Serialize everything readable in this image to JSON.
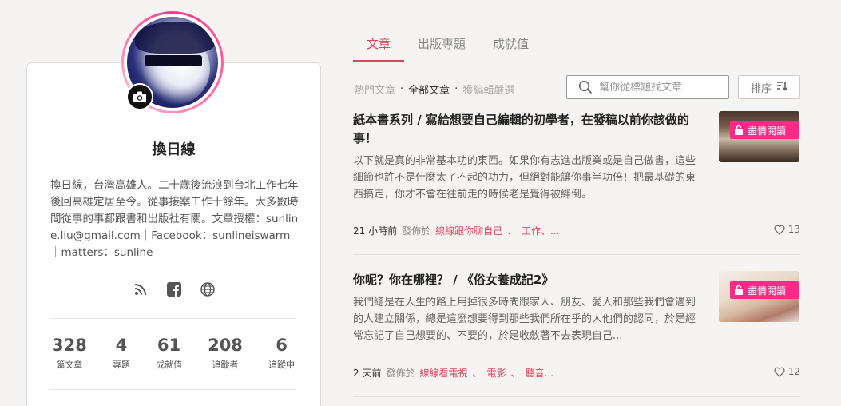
{
  "profile": {
    "name": "換日線",
    "bio": "換日線，台灣高雄人。二十歲後流浪到台北工作七年後回高雄定居至今。從事接案工作十餘年。大多數時間從事的事都跟書和出版社有關。文章授權：sunline.liu@gmail.com｜Facebook：sunlineiswarm｜matters：sunline",
    "stats": [
      {
        "value": "328",
        "label": "篇文章"
      },
      {
        "value": "4",
        "label": "專題"
      },
      {
        "value": "61",
        "label": "成就值"
      },
      {
        "value": "208",
        "label": "追蹤者"
      },
      {
        "value": "6",
        "label": "追蹤中"
      }
    ],
    "social_icons": [
      "rss-icon",
      "facebook-icon",
      "globe-icon"
    ]
  },
  "tabs": [
    {
      "label": "文章",
      "active": true
    },
    {
      "label": "出版專題",
      "active": false
    },
    {
      "label": "成就值",
      "active": false
    }
  ],
  "filters": {
    "hot": "熱門文章",
    "all": "全部文章",
    "editor": "獲編輯嚴選",
    "separator": "·"
  },
  "search": {
    "placeholder": "幫你從標題找文章"
  },
  "sort": {
    "label": "排序"
  },
  "articles": [
    {
      "title": "紙本書系列 / 寫給想要自己編輯的初學者，在發稿以前你該做的事！",
      "excerpt": "以下就是真的非常基本功的東西。如果你有志進出版業或是自己做書，這些細節也許不是什麼太了不起的功力，但絕對能讓你事半功倍！把最基礎的東西搞定，你才不會在往前走的時候老是覺得被絆倒。",
      "time": "21 小時前",
      "published_in": "發佈於",
      "tags": [
        "線線跟你聊自己",
        "工作、..."
      ],
      "likes": "13",
      "badge": "盡情閱讀"
    },
    {
      "title": "你呢？你在哪裡？ / 《俗女養成記2》",
      "excerpt": "我們總是在人生的路上用掉很多時間跟家人、朋友、愛人和那些我們會遇到的人建立關係，總是這麼想要得到那些我們所在乎的人他們的認同，於是經常忘記了自己想要的、不要的，於是收斂著不去表現自己...",
      "time": "2 天前",
      "published_in": "發佈於",
      "tags": [
        "線線看電視",
        "電影",
        "聽音..."
      ],
      "likes": "12",
      "badge": "盡情閱讀"
    }
  ],
  "colors": {
    "accent": "#e0445a",
    "badge": "#ff2a88"
  }
}
